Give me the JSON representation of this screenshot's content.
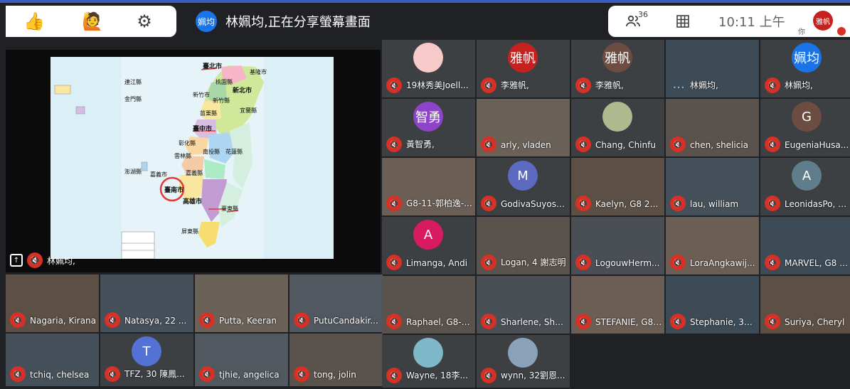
{
  "toolbar": {
    "thumbs_icon": "👍",
    "hand_icon": "🙋",
    "gear_icon": "⚙",
    "presenter_avatar": "姵均",
    "presenter_text": "林姵均,正在分享螢幕畫面",
    "people_count": "36",
    "people_icon": "people-icon",
    "grid_icon": "grid-icon",
    "time": "10:11 上午",
    "self_label": "你",
    "self_avatar": "雅帆"
  },
  "share": {
    "name": "林姵均,",
    "map_labels": {
      "taipei": "臺北市",
      "keelung": "基隆市",
      "taoyuan": "桃園縣",
      "newtaipei": "新北市",
      "hsinchucity": "新竹市",
      "hsinchucounty": "新竹縣",
      "yilan": "宜蘭縣",
      "miaoli": "苗栗縣",
      "taichung": "臺中市",
      "changhua": "彰化縣",
      "nantou": "南投縣",
      "hualien": "花蓮縣",
      "yunlin": "雲林縣",
      "chiayicity": "嘉義市",
      "chiayicounty": "嘉義縣",
      "penghu": "澎湖縣",
      "tainan": "臺南市",
      "kaohsiung": "高雄市",
      "taitung": "臺東縣",
      "pingtung": "屏東縣",
      "lienchiang": "連江縣",
      "kinmen": "金門縣"
    }
  },
  "participants": [
    {
      "name": "19林秀美Joell...",
      "avatar": "",
      "color": "#f8c9c9"
    },
    {
      "name": "李雅帆,",
      "avatar": "雅帆",
      "color": "#c5221f"
    },
    {
      "name": "李雅帆,",
      "avatar": "雅帆",
      "color": "#6d4c41"
    },
    {
      "name": "林姵均,",
      "avatar": "",
      "color": ""
    },
    {
      "name": "林姵均,",
      "avatar": "姵均",
      "color": "#1a73e8"
    },
    {
      "name": "黃智勇,",
      "avatar": "智勇",
      "color": "#8e44c9"
    },
    {
      "name": "arly, vladen",
      "avatar": "",
      "color": ""
    },
    {
      "name": "Chang, Chinfu",
      "avatar": "",
      "color": "#b0b88f"
    },
    {
      "name": "chen, shelicia",
      "avatar": "",
      "color": ""
    },
    {
      "name": "EugeniaHusa...",
      "avatar": "G",
      "color": "#6d4c41"
    },
    {
      "name": "G8-11-郭柏逸-...",
      "avatar": "",
      "color": ""
    },
    {
      "name": "GodivaSuyoso...",
      "avatar": "M",
      "color": "#5c6bc0"
    },
    {
      "name": "Kaelyn, G8 26 ...",
      "avatar": "",
      "color": ""
    },
    {
      "name": "lau, william",
      "avatar": "",
      "color": ""
    },
    {
      "name": "LeonidasPo, A...",
      "avatar": "A",
      "color": "#607d8b"
    },
    {
      "name": "Limanga, Andi",
      "avatar": "A",
      "color": "#d81b60"
    },
    {
      "name": "Logan, 4 謝志明",
      "avatar": "",
      "color": ""
    },
    {
      "name": "LogouwHerm...",
      "avatar": "",
      "color": ""
    },
    {
      "name": "LoraAngkawij...",
      "avatar": "",
      "color": ""
    },
    {
      "name": "MARVEL, G8 0...",
      "avatar": "",
      "color": ""
    },
    {
      "name": "Nagaria, Kirana",
      "avatar": "",
      "color": ""
    },
    {
      "name": "Natasya, 22 ...",
      "avatar": "",
      "color": ""
    },
    {
      "name": "Putta, Keeran",
      "avatar": "",
      "color": ""
    },
    {
      "name": "PutuCandakir...",
      "avatar": "",
      "color": ""
    },
    {
      "name": "Raphael, G8-1...",
      "avatar": "",
      "color": ""
    },
    {
      "name": "Sharlene, Shar...",
      "avatar": "",
      "color": ""
    },
    {
      "name": "STEFANIE, G8 ...",
      "avatar": "",
      "color": ""
    },
    {
      "name": "Stephanie, 31 ...",
      "avatar": "",
      "color": ""
    },
    {
      "name": "Suriya, Cheryl",
      "avatar": "",
      "color": ""
    },
    {
      "name": "tchiq, chelsea",
      "avatar": "",
      "color": ""
    },
    {
      "name": "TFZ, 30 陳鳳...",
      "avatar": "T",
      "color": "#5472d3"
    },
    {
      "name": "tjhie, angelica",
      "avatar": "",
      "color": ""
    },
    {
      "name": "tong, jolin",
      "avatar": "",
      "color": ""
    },
    {
      "name": "Wayne, 18李...",
      "avatar": "",
      "color": "#7fb8c8"
    },
    {
      "name": "wynn, 32劉恩...",
      "avatar": "",
      "color": "#8aa2b8"
    }
  ]
}
